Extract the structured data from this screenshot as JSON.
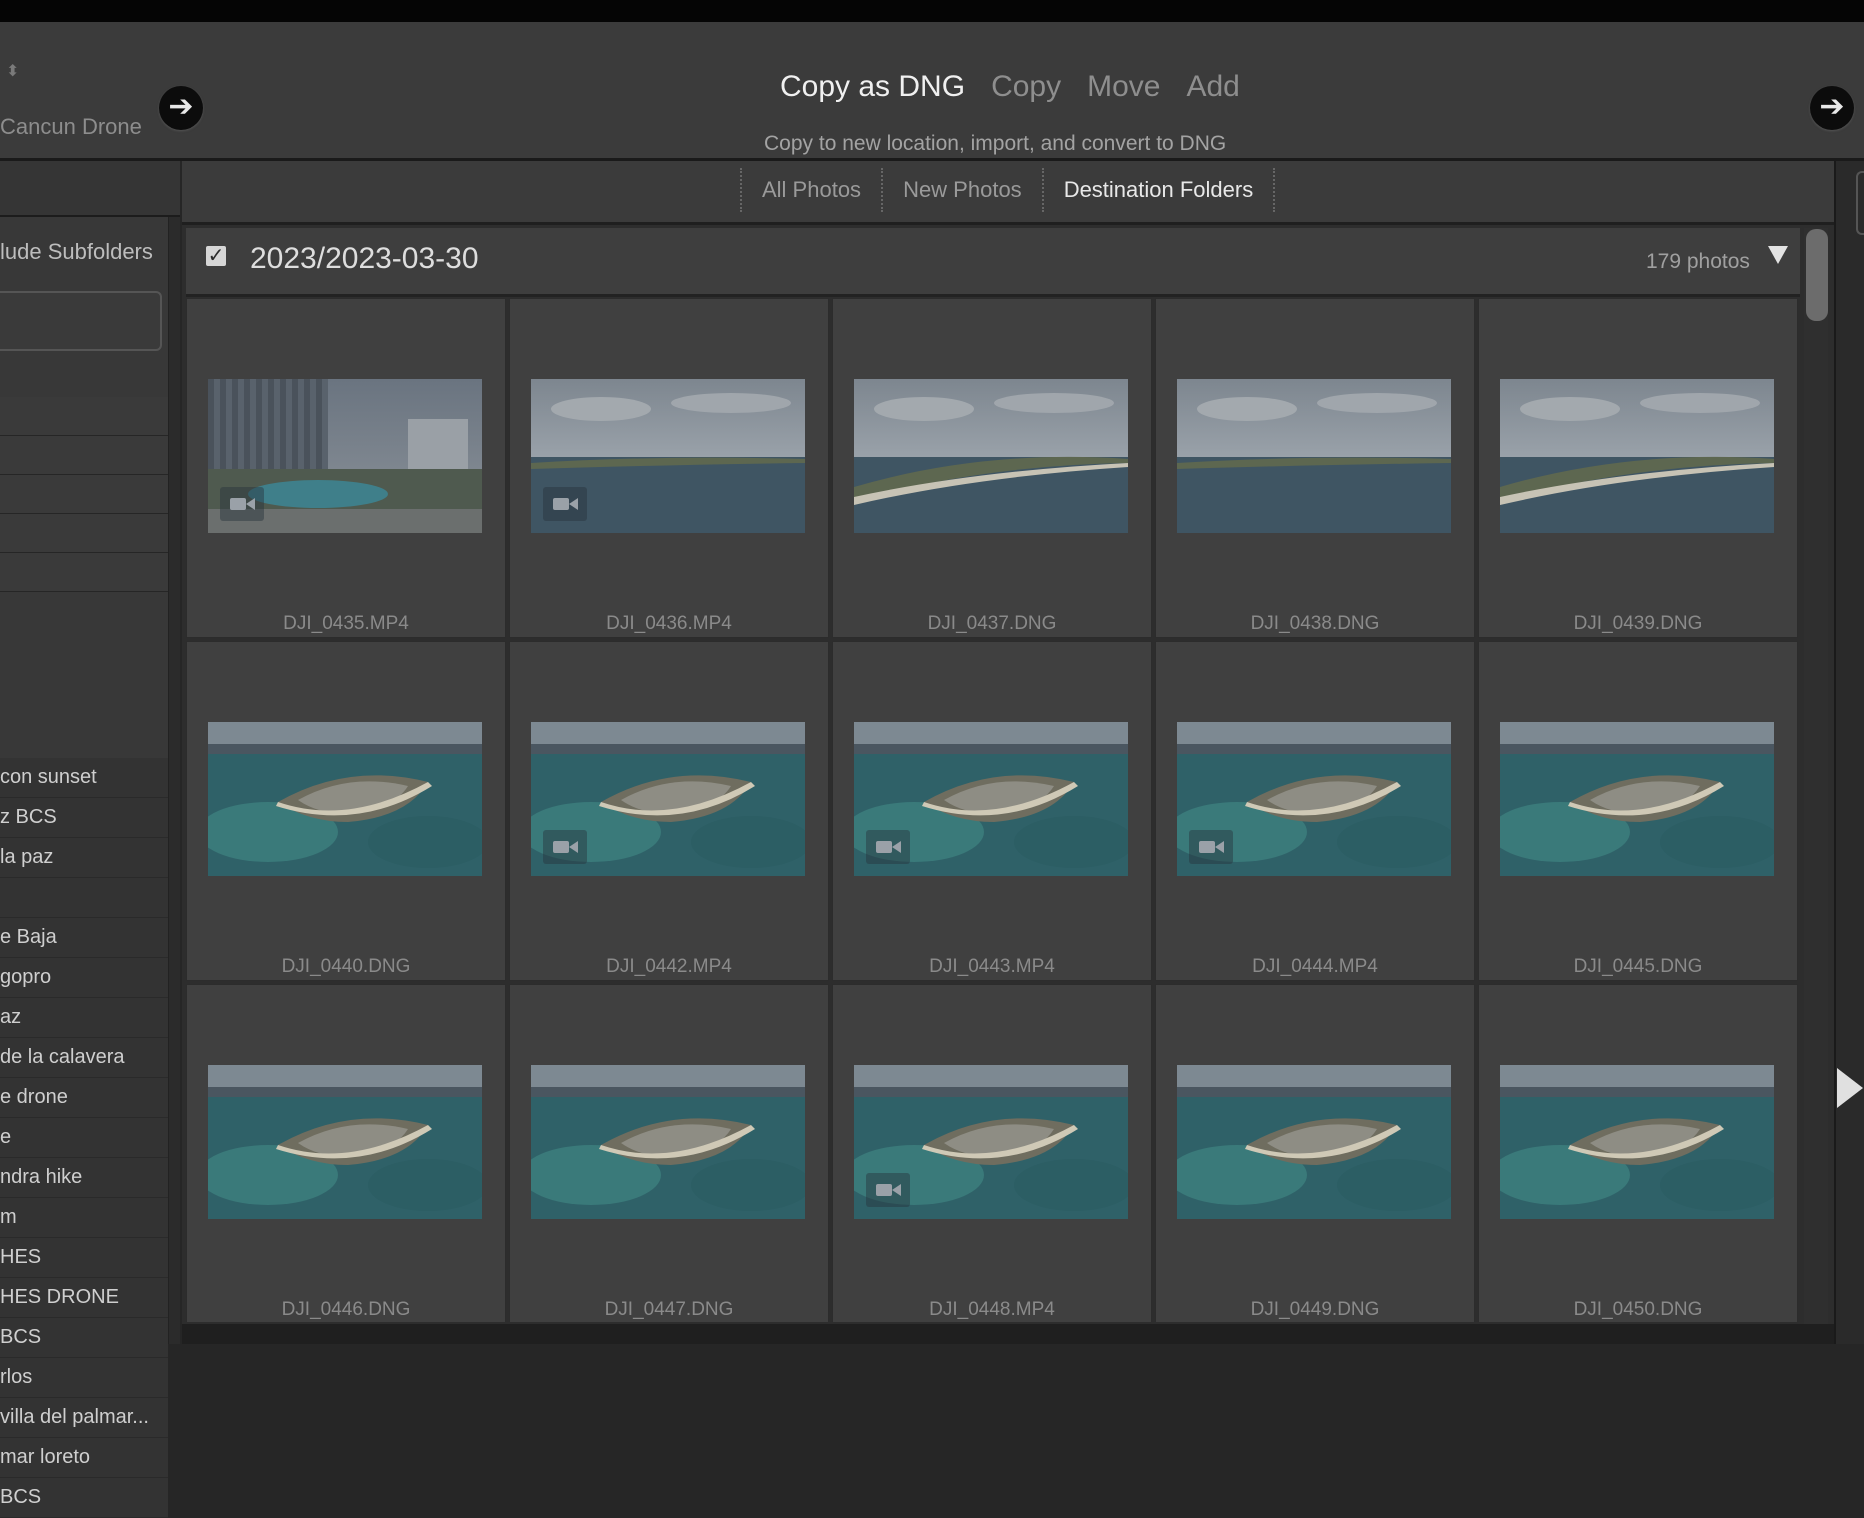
{
  "source": {
    "label": "Cancun Drone"
  },
  "modes": [
    {
      "label": "Copy as DNG",
      "active": true
    },
    {
      "label": "Copy",
      "active": false
    },
    {
      "label": "Move",
      "active": false
    },
    {
      "label": "Add",
      "active": false
    }
  ],
  "mode_description": "Copy to new location, import, and convert to DNG",
  "sidebar": {
    "include_label": "lude Subfolders",
    "folders": [
      "con sunset",
      "z BCS",
      "la paz",
      "",
      "e Baja",
      " gopro",
      "az",
      "de la calavera",
      "e drone",
      "e",
      "ndra hike",
      "m",
      "HES",
      "HES DRONE",
      "BCS",
      "rlos",
      "villa del palmar...",
      "mar loreto",
      "BCS"
    ]
  },
  "tabs": [
    {
      "label": "All Photos",
      "active": false
    },
    {
      "label": "New Photos",
      "active": false
    },
    {
      "label": "Destination Folders",
      "active": true
    }
  ],
  "folder": {
    "checked": true,
    "check_mark": "✓",
    "title": "2023/2023-03-30",
    "count": "179 photos"
  },
  "photos": [
    {
      "name": "DJI_0435.MP4",
      "video": true,
      "scene": "hotel"
    },
    {
      "name": "DJI_0436.MP4",
      "video": true,
      "scene": "sea"
    },
    {
      "name": "DJI_0437.DNG",
      "video": false,
      "scene": "sea-coast"
    },
    {
      "name": "DJI_0438.DNG",
      "video": false,
      "scene": "sea"
    },
    {
      "name": "DJI_0439.DNG",
      "video": false,
      "scene": "sea-coast"
    },
    {
      "name": "DJI_0440.DNG",
      "video": false,
      "scene": "peninsula"
    },
    {
      "name": "DJI_0442.MP4",
      "video": true,
      "scene": "peninsula"
    },
    {
      "name": "DJI_0443.MP4",
      "video": true,
      "scene": "peninsula"
    },
    {
      "name": "DJI_0444.MP4",
      "video": true,
      "scene": "peninsula"
    },
    {
      "name": "DJI_0445.DNG",
      "video": false,
      "scene": "peninsula"
    },
    {
      "name": "DJI_0446.DNG",
      "video": false,
      "scene": "peninsula"
    },
    {
      "name": "DJI_0447.DNG",
      "video": false,
      "scene": "peninsula"
    },
    {
      "name": "DJI_0448.MP4",
      "video": true,
      "scene": "peninsula"
    },
    {
      "name": "DJI_0449.DNG",
      "video": false,
      "scene": "peninsula"
    },
    {
      "name": "DJI_0450.DNG",
      "video": false,
      "scene": "peninsula"
    }
  ],
  "icons": {
    "back": "arrow-right-icon",
    "forward": "arrow-right-icon",
    "collapse": "triangle-down-icon",
    "video": "video-camera-icon"
  }
}
